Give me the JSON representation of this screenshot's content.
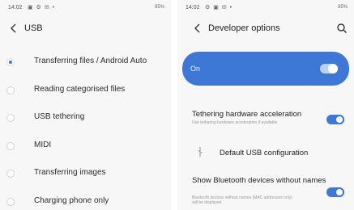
{
  "left": {
    "status": {
      "time": "14:02",
      "icons": "▣ ⚙ ✉ •",
      "battery": "95%"
    },
    "title": "USB",
    "options": [
      {
        "label": "Transferring files / Android Auto",
        "selected": true
      },
      {
        "label": "Reading categorised files",
        "selected": false
      },
      {
        "label": "USB tethering",
        "selected": false
      },
      {
        "label": "MIDI",
        "selected": false
      },
      {
        "label": "Transferring images",
        "selected": false
      },
      {
        "label": "Charging phone only",
        "selected": false
      }
    ]
  },
  "right": {
    "status": {
      "time": "14:02",
      "icons": "⚙ ▣ ✉ •",
      "battery": "95%"
    },
    "title": "Developer options",
    "master": {
      "label": "On",
      "enabled": true
    },
    "settings": {
      "tethering": {
        "title": "Tethering hardware acceleration",
        "subtitle": "Use tethering hardware acceleration if available",
        "enabled": true
      },
      "usb_config": {
        "title": "Default USB configuration"
      },
      "bluetooth": {
        "title": "Show Bluetooth devices without names",
        "subtitle": "Bluetooth devices without names (MAC addresses only) will be displayed",
        "enabled": true
      }
    }
  },
  "colors": {
    "accent": "#3e78d6",
    "background": "#f7f7f7"
  },
  "icons": [
    "back-arrow-icon",
    "search-icon",
    "usb-icon",
    "radio-icon",
    "toggle-icon"
  ]
}
